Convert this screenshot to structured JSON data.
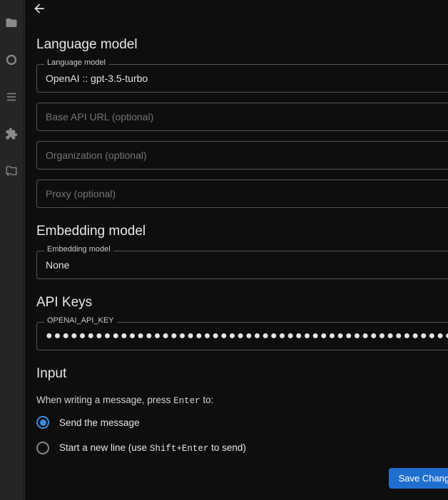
{
  "activitybar": {
    "items": [
      "folder",
      "circle",
      "list",
      "puzzle",
      "chat"
    ]
  },
  "sections": {
    "language_model": {
      "title": "Language model",
      "select_label": "Language model",
      "select_value": "OpenAI :: gpt-3.5-turbo",
      "base_api_url_placeholder": "Base API URL (optional)",
      "organization_placeholder": "Organization (optional)",
      "proxy_placeholder": "Proxy (optional)"
    },
    "embedding_model": {
      "title": "Embedding model",
      "select_label": "Embedding model",
      "select_value": "None"
    },
    "api_keys": {
      "title": "API Keys",
      "key_label": "OPENAI_API_KEY",
      "key_mask": "●●●●●●●●●●●●●●●●●●●●●●●●●●●●●●●●●●●●●●●●●●●●●●●●●●●"
    },
    "input": {
      "title": "Input",
      "hint_prefix": "When writing a message, press ",
      "hint_key": "Enter",
      "hint_suffix": " to:",
      "option_send": "Send the message",
      "option_newline_prefix": "Start a new line (use ",
      "option_newline_key": "Shift+Enter",
      "option_newline_suffix": " to send)",
      "selected": "send"
    }
  },
  "save_button": "Save Changes"
}
